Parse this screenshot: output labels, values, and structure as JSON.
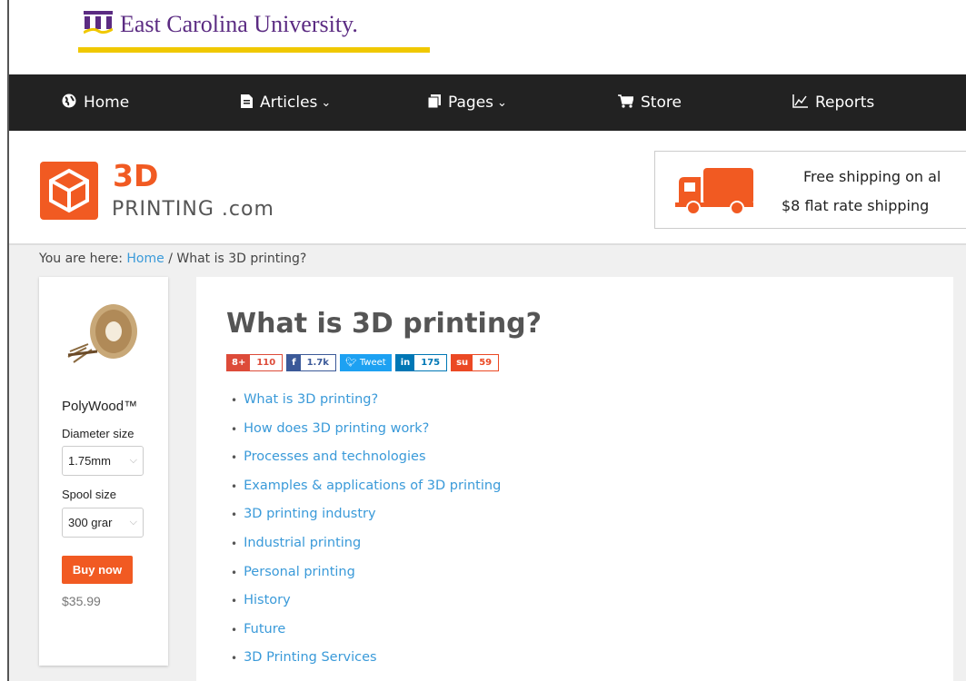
{
  "university": {
    "name": "East Carolina University."
  },
  "nav": {
    "items": [
      {
        "label": "Home",
        "icon": "globe-icon",
        "dropdown": false
      },
      {
        "label": "Articles",
        "icon": "document-icon",
        "dropdown": true
      },
      {
        "label": "Pages",
        "icon": "pages-icon",
        "dropdown": true
      },
      {
        "label": "Store",
        "icon": "cart-icon",
        "dropdown": false
      },
      {
        "label": "Reports",
        "icon": "chart-icon",
        "dropdown": false
      }
    ]
  },
  "brand": {
    "main": "3D",
    "sub": "PRINTING .com",
    "color": "#f15a22"
  },
  "shipping": {
    "line1": "Free shipping on al",
    "line2": "$8 flat rate shipping"
  },
  "breadcrumb": {
    "prefix": "You are here:",
    "home": "Home",
    "separator": "/",
    "current": "What is 3D printing?"
  },
  "product": {
    "name": "PolyWood™",
    "diameter_label": "Diameter size",
    "diameter_value": "1.75mm",
    "spool_label": "Spool size",
    "spool_value": "300 grar",
    "buy_label": "Buy now",
    "price": "$35.99"
  },
  "article": {
    "title": "What is 3D printing?",
    "shares": [
      {
        "network": "google-plus",
        "glyph": "8+",
        "count": "110",
        "color": "#dd4b39"
      },
      {
        "network": "facebook",
        "glyph": "f",
        "count": "1.7k",
        "color": "#3b5998"
      },
      {
        "network": "twitter",
        "glyph": "Tweet",
        "count": "",
        "color": "#1da1f2"
      },
      {
        "network": "linkedin",
        "glyph": "in",
        "count": "175",
        "color": "#0077b5"
      },
      {
        "network": "stumbleupon",
        "glyph": "su",
        "count": "59",
        "color": "#eb4924"
      }
    ],
    "toc": [
      "What is 3D printing?",
      "How does 3D printing work?",
      "Processes and technologies",
      "Examples & applications of 3D printing",
      "3D printing industry",
      "Industrial printing",
      "Personal printing",
      "History",
      "Future",
      "3D Printing Services"
    ]
  }
}
